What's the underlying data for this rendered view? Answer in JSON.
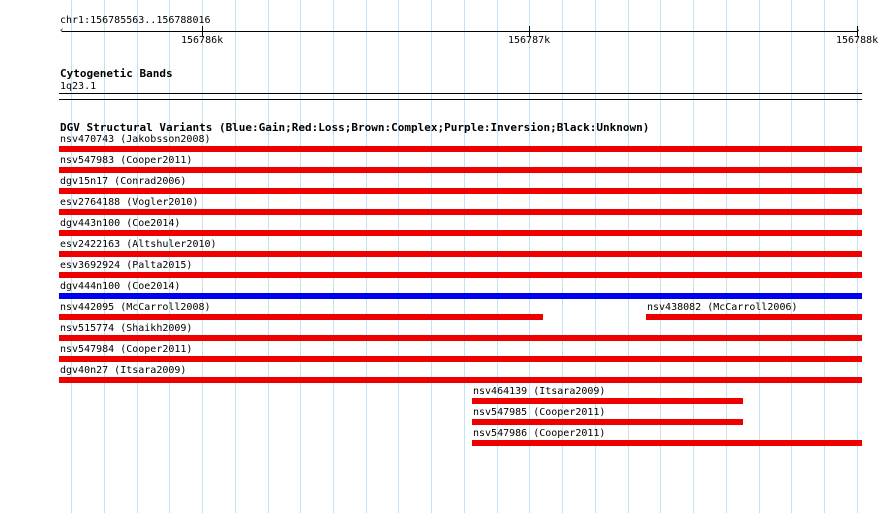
{
  "locus": "chr1:156785563..156788016",
  "colors": {
    "gain": "#0000ee",
    "loss": "#ee0000",
    "grid": "#bfe3f2"
  },
  "ruler": {
    "start": 156785563,
    "end": 156788016,
    "ticks": [
      {
        "pos": 156786000,
        "label": "156786k"
      },
      {
        "pos": 156787000,
        "label": "156787k"
      },
      {
        "pos": 156788000,
        "label": "156788k"
      }
    ]
  },
  "cytoband": {
    "title": "Cytogenetic Bands",
    "band": "1q23.1"
  },
  "dgv": {
    "title": "DGV Structural Variants (Blue:Gain;Red:Loss;Brown:Complex;Purple:Inversion;Black:Unknown)",
    "features": [
      {
        "label": "nsv470743 (Jakobsson2008)",
        "start": 156785563,
        "end": 156788016,
        "type": "loss",
        "row": 0
      },
      {
        "label": "nsv547983 (Cooper2011)",
        "start": 156785563,
        "end": 156788016,
        "type": "loss",
        "row": 1
      },
      {
        "label": "dgv15n17 (Conrad2006)",
        "start": 156785563,
        "end": 156788016,
        "type": "loss",
        "row": 2
      },
      {
        "label": "esv2764188 (Vogler2010)",
        "start": 156785563,
        "end": 156788016,
        "type": "loss",
        "row": 3
      },
      {
        "label": "dgv443n100 (Coe2014)",
        "start": 156785563,
        "end": 156788016,
        "type": "loss",
        "row": 4
      },
      {
        "label": "esv2422163 (Altshuler2010)",
        "start": 156785563,
        "end": 156788016,
        "type": "loss",
        "row": 5
      },
      {
        "label": "esv3692924 (Palta2015)",
        "start": 156785563,
        "end": 156788016,
        "type": "loss",
        "row": 6
      },
      {
        "label": "dgv444n100 (Coe2014)",
        "start": 156785563,
        "end": 156788016,
        "type": "gain",
        "row": 7
      },
      {
        "label": "nsv442095 (McCarroll2008)",
        "start": 156785563,
        "end": 156787040,
        "type": "loss",
        "row": 8
      },
      {
        "label": "nsv438082 (McCarroll2006)",
        "start": 156787355,
        "end": 156788016,
        "type": "loss",
        "row": 8
      },
      {
        "label": "nsv515774 (Shaikh2009)",
        "start": 156785563,
        "end": 156788016,
        "type": "loss",
        "row": 9
      },
      {
        "label": "nsv547984 (Cooper2011)",
        "start": 156785563,
        "end": 156788016,
        "type": "loss",
        "row": 10
      },
      {
        "label": "dgv40n27 (Itsara2009)",
        "start": 156785563,
        "end": 156788016,
        "type": "loss",
        "row": 11
      },
      {
        "label": "nsv464139 (Itsara2009)",
        "start": 156786826,
        "end": 156787652,
        "type": "loss",
        "row": 12
      },
      {
        "label": "nsv547985 (Cooper2011)",
        "start": 156786826,
        "end": 156787652,
        "type": "loss",
        "row": 13
      },
      {
        "label": "nsv547986 (Cooper2011)",
        "start": 156786826,
        "end": 156788016,
        "type": "loss",
        "row": 14
      }
    ]
  }
}
